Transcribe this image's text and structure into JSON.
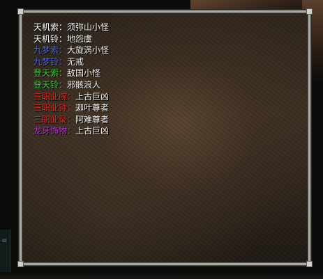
{
  "panel": {
    "lines": [
      {
        "label": "天机索",
        "sep": "：",
        "value": "须弥山小怪",
        "label_color": "#ffffff"
      },
      {
        "label": "天机铃",
        "sep": "：",
        "value": "地怨虞",
        "label_color": "#ffffff"
      },
      {
        "label": "九梦索",
        "sep": "：",
        "value": "大旋涡小怪",
        "label_color": "#4f63d8"
      },
      {
        "label": "九梦铃",
        "sep": "：",
        "value": "无戒",
        "label_color": "#4f63d8"
      },
      {
        "label": "登天索",
        "sep": "：",
        "value": "敌国小怪",
        "label_color": "#3fc23f"
      },
      {
        "label": "登天铃",
        "sep": "：",
        "value": "邪骸浪人",
        "label_color": "#3fc23f"
      },
      {
        "label": "三职业腕",
        "sep": "：",
        "value": "上古巨凶",
        "label_color": "#d12a2a"
      },
      {
        "label": "三职业钟",
        "sep": "：",
        "value": "迦叶尊者",
        "label_color": "#d12a2a"
      },
      {
        "label": "三职业录",
        "sep": "：",
        "value": "阿难尊者",
        "label_color": "#d12a2a"
      },
      {
        "label": "龙牙饰物",
        "sep": "：",
        "value": "上古巨凶",
        "label_color": "#b23ac8"
      }
    ]
  },
  "colors": {
    "frame": "#a9a9a6",
    "value_text": "#f2f2f2"
  }
}
